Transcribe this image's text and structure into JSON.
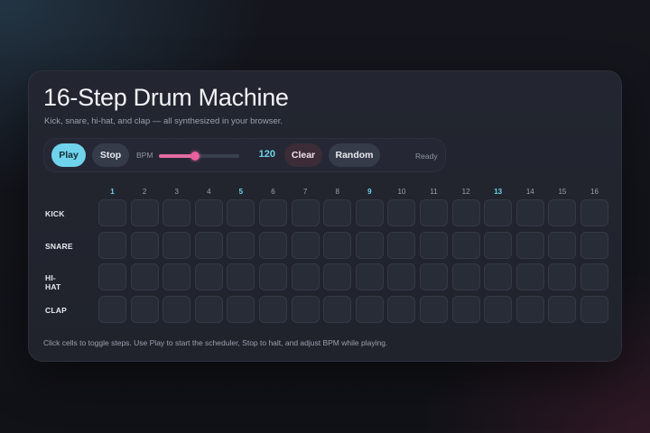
{
  "app": {
    "title": "16-Step Drum Machine",
    "subtitle": "Kick, snare, hi-hat, and clap — all synthesized in your browser."
  },
  "toolbar": {
    "play_label": "Play",
    "stop_label": "Stop",
    "bpm_label": "BPM",
    "bpm_value": "120",
    "bpm_min": 60,
    "bpm_max": 180,
    "bpm_fraction": 0.45,
    "clear_label": "Clear",
    "random_label": "Random",
    "status": "Ready"
  },
  "steps": [
    "1",
    "2",
    "3",
    "4",
    "5",
    "6",
    "7",
    "8",
    "9",
    "10",
    "11",
    "12",
    "13",
    "14",
    "15",
    "16"
  ],
  "beat_steps": [
    0,
    4,
    8,
    12
  ],
  "tracks": [
    {
      "label": "KICK",
      "pattern": [
        0,
        0,
        0,
        0,
        0,
        0,
        0,
        0,
        0,
        0,
        0,
        0,
        0,
        0,
        0,
        0
      ]
    },
    {
      "label": "SNARE",
      "pattern": [
        0,
        0,
        0,
        0,
        0,
        0,
        0,
        0,
        0,
        0,
        0,
        0,
        0,
        0,
        0,
        0
      ]
    },
    {
      "label": "HI-HAT",
      "pattern": [
        0,
        0,
        0,
        0,
        0,
        0,
        0,
        0,
        0,
        0,
        0,
        0,
        0,
        0,
        0,
        0
      ]
    },
    {
      "label": "CLAP",
      "pattern": [
        0,
        0,
        0,
        0,
        0,
        0,
        0,
        0,
        0,
        0,
        0,
        0,
        0,
        0,
        0,
        0
      ]
    }
  ],
  "footer": "Click cells to toggle steps. Use Play to start the scheduler, Stop to halt, and adjust BPM while playing.",
  "colors": {
    "accent": "#6fd3ec",
    "slider": "#e56ba3",
    "clear_bg": "#3b2c38",
    "cell_bg": "#282c37"
  }
}
